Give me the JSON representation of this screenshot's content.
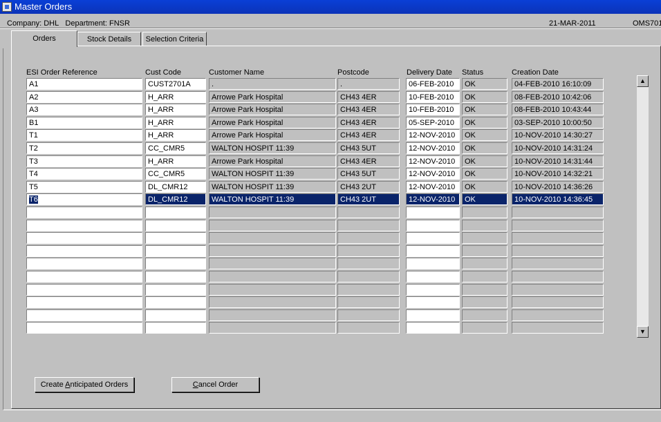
{
  "window": {
    "title": "Master Orders"
  },
  "info": {
    "company_label": "Company:",
    "company": "DHL",
    "department_label": "Department:",
    "department": "FNSR",
    "date": "21-MAR-2011",
    "form_code": "OMS701"
  },
  "tabs": [
    {
      "label": "Orders",
      "active": true
    },
    {
      "label": "Stock Details",
      "active": false
    },
    {
      "label": "Selection Criteria",
      "active": false
    }
  ],
  "table": {
    "columns": [
      "ESI Order Reference",
      "Cust Code",
      "Customer Name",
      "Postcode",
      "Delivery Date",
      "Status",
      "Creation Date"
    ],
    "rows": [
      [
        "A1",
        "CUST2701A",
        ".",
        ".",
        "06-FEB-2010",
        "OK",
        "04-FEB-2010 16:10:09"
      ],
      [
        "A2",
        "H_ARR",
        "Arrowe Park Hospital",
        "CH43 4ER",
        "10-FEB-2010",
        "OK",
        "08-FEB-2010 10:42:06"
      ],
      [
        "A3",
        "H_ARR",
        "Arrowe Park Hospital",
        "CH43 4ER",
        "10-FEB-2010",
        "OK",
        "08-FEB-2010 10:43:44"
      ],
      [
        "B1",
        "H_ARR",
        "Arrowe Park Hospital",
        "CH43 4ER",
        "05-SEP-2010",
        "OK",
        "03-SEP-2010 10:00:50"
      ],
      [
        "T1",
        "H_ARR",
        "Arrowe Park Hospital",
        "CH43 4ER",
        "12-NOV-2010",
        "OK",
        "10-NOV-2010 14:30:27"
      ],
      [
        "T2",
        "CC_CMR5",
        "WALTON HOSPIT 11:39",
        "CH43 5UT",
        "12-NOV-2010",
        "OK",
        "10-NOV-2010 14:31:24"
      ],
      [
        "T3",
        "H_ARR",
        "Arrowe Park Hospital",
        "CH43 4ER",
        "12-NOV-2010",
        "OK",
        "10-NOV-2010 14:31:44"
      ],
      [
        "T4",
        "CC_CMR5",
        "WALTON HOSPIT 11:39",
        "CH43 5UT",
        "12-NOV-2010",
        "OK",
        "10-NOV-2010 14:32:21"
      ],
      [
        "T5",
        "DL_CMR12",
        "WALTON HOSPIT 11:39",
        "CH43 2UT",
        "12-NOV-2010",
        "OK",
        "10-NOV-2010 14:36:26"
      ],
      [
        "T6",
        "DL_CMR12",
        "WALTON HOSPIT 11:39",
        "CH43 2UT",
        "12-NOV-2010",
        "OK",
        "10-NOV-2010 14:36:45"
      ]
    ],
    "selected_row": 9,
    "total_rows_visible": 20
  },
  "buttons": {
    "create_pre": "Create ",
    "create_key": "A",
    "create_post": "nticipated Orders",
    "cancel_pre": "",
    "cancel_key": "C",
    "cancel_post": "ancel Order"
  },
  "scrollbar": {
    "up_icon": "▲",
    "down_icon": "▼"
  },
  "colors": {
    "titlebar": "#0a3fd6",
    "selection": "#0a246a",
    "face": "#c0c0c0"
  }
}
